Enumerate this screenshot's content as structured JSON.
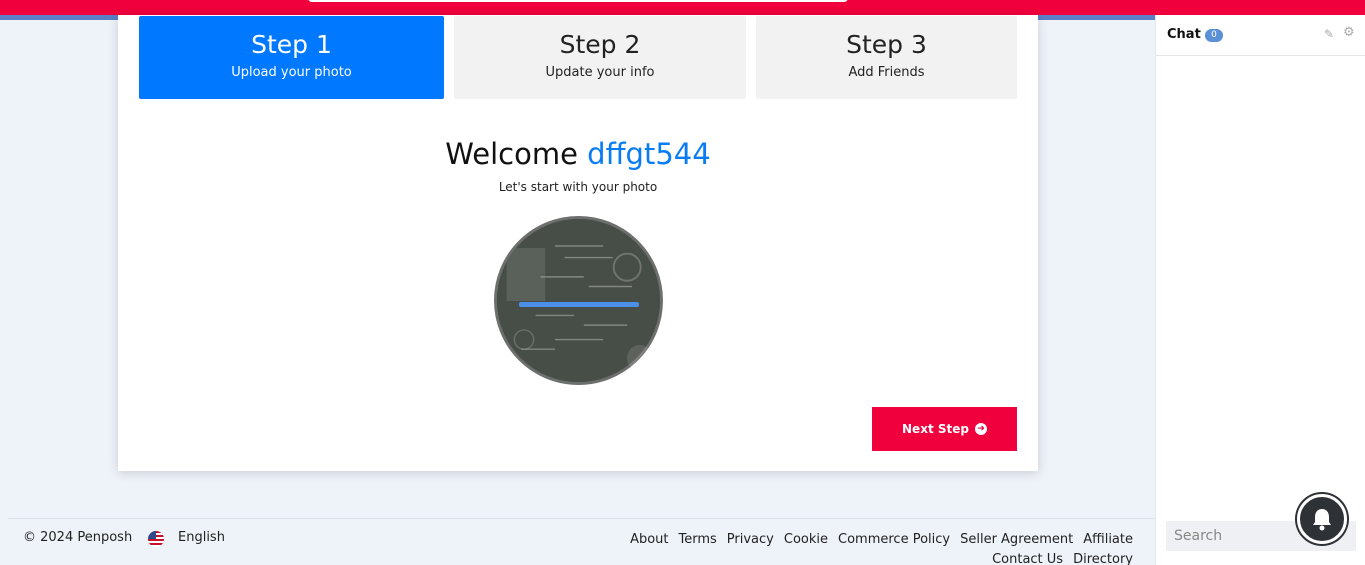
{
  "steps": [
    {
      "title": "Step 1",
      "subtitle": "Upload your photo"
    },
    {
      "title": "Step 2",
      "subtitle": "Update your info"
    },
    {
      "title": "Step 3",
      "subtitle": "Add Friends"
    }
  ],
  "welcome": {
    "prefix": "Welcome ",
    "username": "dffgt544",
    "subtitle": "Let's start with your photo"
  },
  "upload": {
    "progress_percent": 100
  },
  "next_button": {
    "label": "Next Step"
  },
  "footer": {
    "copyright": "© 2024 Penposh",
    "language": "English",
    "links": [
      "About",
      "Terms",
      "Privacy",
      "Cookie",
      "Commerce Policy",
      "Seller Agreement",
      "Affiliate",
      "Contact Us",
      "Directory"
    ]
  },
  "chat": {
    "title": "Chat",
    "count": "0",
    "search_placeholder": "Search"
  },
  "colors": {
    "brand_red": "#f0003c",
    "active_blue": "#0078ff",
    "username_blue": "#0a7cf3"
  },
  "icons": {
    "next": "arrow-circle-right-icon",
    "edit": "edit-icon",
    "settings": "gear-icon",
    "notifications": "bell-icon",
    "language": "us-flag-icon"
  }
}
